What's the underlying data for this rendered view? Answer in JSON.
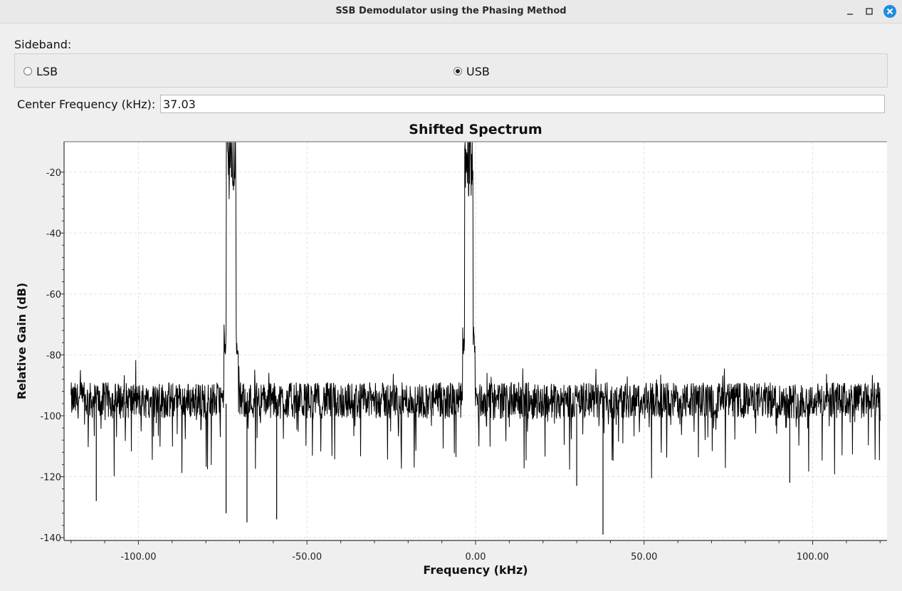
{
  "window": {
    "title": "SSB Demodulator using the Phasing Method",
    "buttons": [
      "minimize-icon",
      "maximize-icon",
      "close-icon"
    ],
    "close_color": "#1f8ee0"
  },
  "sideband": {
    "label": "Sideband:",
    "options": [
      {
        "label": "LSB",
        "checked": false
      },
      {
        "label": "USB",
        "checked": true
      }
    ]
  },
  "center_frequency": {
    "label": "Center Frequency (kHz):",
    "value": "37.03"
  },
  "chart_data": {
    "type": "line",
    "title": "Shifted Spectrum",
    "xlabel": "Frequency (kHz)",
    "ylabel": "Relative Gain (dB)",
    "xlim": [
      -121,
      121
    ],
    "ylim": [
      -140,
      -10
    ],
    "x_ticks": [
      -100,
      -50,
      0,
      50,
      100
    ],
    "x_tick_labels": [
      "-100.00",
      "-50.00",
      "0.00",
      "50.00",
      "100.00"
    ],
    "y_ticks": [
      -20,
      -40,
      -60,
      -80,
      -100,
      -120,
      -140
    ],
    "y_tick_labels": [
      "-20",
      "-40",
      "-60",
      "-80",
      "-100",
      "-120",
      "-140"
    ],
    "grid": true,
    "series": [
      {
        "noise_floor_db": -95,
        "peaks": [
          {
            "center_khz": -72.5,
            "width_khz": 3.0,
            "max_db": -29
          },
          {
            "center_khz": -2.0,
            "width_khz": 2.5,
            "max_db": -29
          }
        ],
        "notable_dips": [
          {
            "x": -74.0,
            "y": -132
          },
          {
            "x": -67.8,
            "y": -135
          },
          {
            "x": -59.0,
            "y": -134
          },
          {
            "x": 37.8,
            "y": -139
          },
          {
            "x": 30.0,
            "y": -123
          },
          {
            "x": -112.5,
            "y": -128
          },
          {
            "x": 93.2,
            "y": -122
          }
        ]
      }
    ]
  }
}
